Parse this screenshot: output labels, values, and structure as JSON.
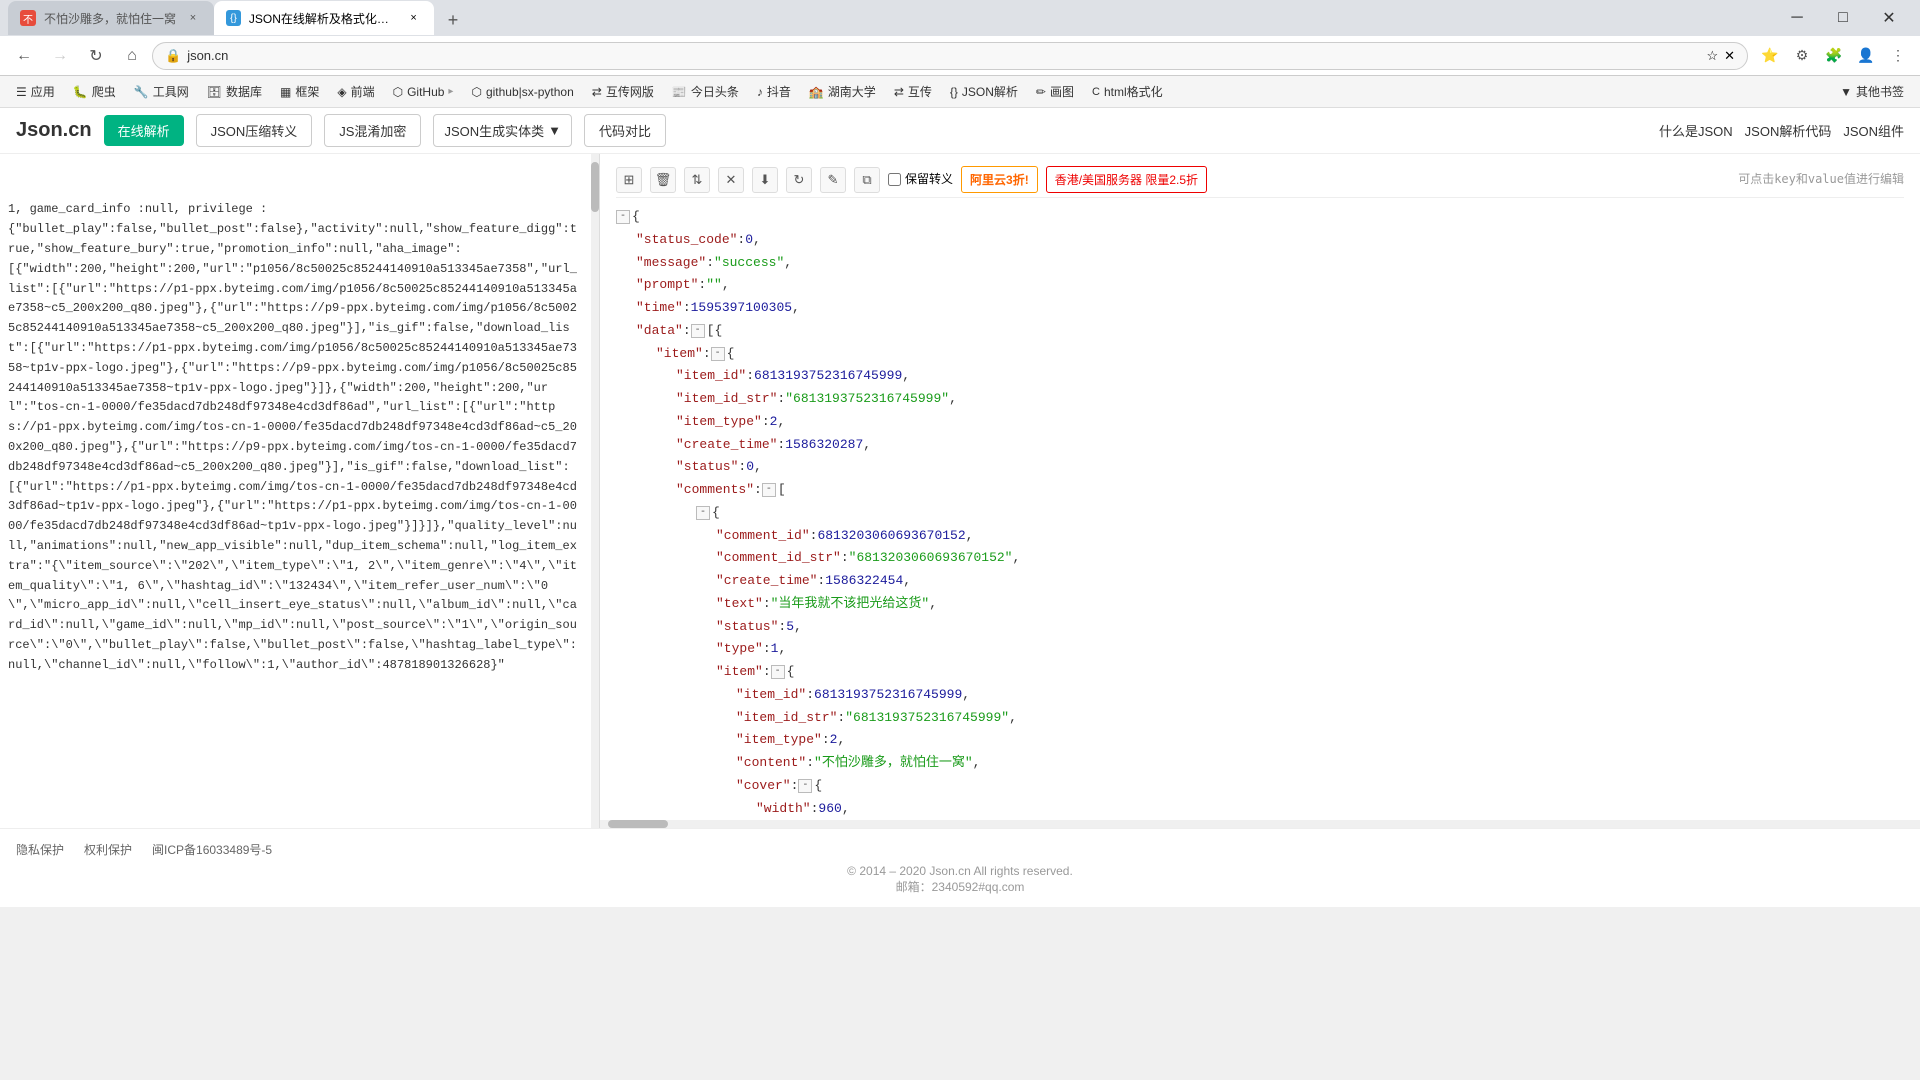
{
  "browser": {
    "tabs": [
      {
        "id": "tab1",
        "title": "不怕沙雕多，就怕住一窝",
        "active": false,
        "icon_type": "red",
        "icon_text": "不"
      },
      {
        "id": "tab2",
        "title": "JSON在线解析及格式化验证 -",
        "active": true,
        "icon_type": "blue",
        "icon_text": "{}"
      }
    ],
    "new_tab_label": "+",
    "address": "json.cn",
    "nav_back_disabled": false,
    "nav_forward_disabled": true
  },
  "bookmarks": [
    {
      "label": "应用",
      "icon": "☰"
    },
    {
      "label": "爬虫",
      "icon": "🐛"
    },
    {
      "label": "工具网",
      "icon": "🔧"
    },
    {
      "label": "数据库",
      "icon": "🗄"
    },
    {
      "label": "框架",
      "icon": "▦"
    },
    {
      "label": "前端",
      "icon": "◈"
    },
    {
      "label": "GitHub",
      "icon": "⬡"
    },
    {
      "label": "github|sx-python",
      "icon": "⬡"
    },
    {
      "label": "互传网版",
      "icon": "⇄"
    },
    {
      "label": "今日头条",
      "icon": "📰"
    },
    {
      "label": "抖音",
      "icon": "♪"
    },
    {
      "label": "湖南大学",
      "icon": "🏫"
    },
    {
      "label": "互传",
      "icon": "⇄"
    },
    {
      "label": "JSON解析",
      "icon": "{}"
    },
    {
      "label": "画图",
      "icon": "✏"
    },
    {
      "label": "html格式化",
      "icon": "< >"
    },
    {
      "label": "其他书签",
      "icon": "▼"
    }
  ],
  "site": {
    "logo": "Json.cn",
    "nav_items": [
      {
        "label": "在线解析",
        "active": true
      },
      {
        "label": "JSON压缩转义"
      },
      {
        "label": "JS混淆加密"
      },
      {
        "label": "JSON生成实体类",
        "has_dropdown": true
      },
      {
        "label": "代码对比"
      }
    ],
    "header_links": [
      {
        "label": "什么是JSON"
      },
      {
        "label": "JSON解析代码"
      },
      {
        "label": "JSON组件"
      }
    ]
  },
  "left_panel": {
    "content": "1, game_card_info :null, privilege :\n{\"bullet_play\":false,\"bullet_post\":false},\"activity\":null,\"show_feature_digg\":true,\"show_feature_bury\":true,\"promotion_info\":null,\"aha_image\":\n[[\"width\":200,\"height\":200,\"url\":\"p1056/8c50025c85244140910a513345ae7358\",\"url_list\":[{\"url\":\"https://p1-ppx.byteimg.com/img/p1056/8c50025c85244140910a513345ae7358~c5_200x200_q80.jpeg\"},{\"url\":\"https://p9-ppx.byteimg.com/img/p1056/8c50025c85244140910a513345ae7358~c5_200x200_q80.jpeg\"}],\"is_gif\":false,\"download_list\":[{\"url\":\"https://p1-ppx.byteimg.com/img/p1056/8c50025c85244140910a513345ae7358~tp1v-ppx-logo.jpeg\"},{\"url\":\"https://p9-ppx.byteimg.com/img/p1056/8c50025c85244140910a513345ae7358~tp1v-ppx-logo.jpeg\"}]},{\"width\":200,\"height\":200,\"url\":\"tos-cn-1-0000/fe35dacd7db248df97348e4cd3df86ad\",\"url_list\":[{\"url\":\"https://p1-ppx.byteimg.com/img/tos-cn-1-0000/fe35dacd7db248df97348e4cd3df86ad~c5_200x200_q80.jpeg\"},{\"url\":\"https://p9-ppx.byteimg.com/img/tos-cn-1-0000/fe35dacd7db248df97348e4cd3df86ad~c5_200x200_q80.jpeg\"}],\"is_gif\":false,\"download_list\":[{\"url\":\"https://p1-ppx.byteimg.com/img/tos-cn-1-0000/fe35dacd7db248df97348e4cd3df86ad~tp1v-ppx-logo.jpeg\"},{\"url\":\"https://p1-ppx.byteimg.com/img/tos-cn-1-0000/fe35dacd7db248df97348e4cd3df86ad~tp1v-ppx-logo.jpeg\"}]]},\"quality_level\":null,\"animations\":null,\"new_app_visible\":null,\"dup_item_schema\":null,\"log_item_extra\":\"{\\\"item_source\\\":\\\"202\\\",\\\"item_type\\\":\\\"1, 2\\\",\\\"item_genre\\\":\\\"4\\\",\\\"item_quality\\\":\\\"1, 6\\\",\\\"hashtag_id\\\":\\\"132434\\\",\\\"item_refer_user_num\\\":\\\"0\\\",\\\"micro_app_id\\\":null,\\\"cell_insert_eye_status\\\":null,\\\"album_id\\\":null,\\\"card_id\\\":null,\\\"game_id\\\":null,\\\"mp_id\\\":null,\\\"post_source\\\":\\\"1\\\",\\\"origin_source\\\":\\\"0\\\",\\\"bullet_play\\\":false,\\\"bullet_post\\\":false,\\\"hashtag_label_type\\\":null,\\\"channel_id\\\":null,\\\"follow\\\":1,\\\"author_id\\\":487818901326628}\"}"
  },
  "right_panel": {
    "toolbar": {
      "buttons": [
        {
          "name": "grid-btn",
          "icon": "⊞"
        },
        {
          "name": "delete-btn",
          "icon": "🗑"
        },
        {
          "name": "sort-btn",
          "icon": "⇅"
        },
        {
          "name": "clear-btn",
          "icon": "✕"
        },
        {
          "name": "download-btn",
          "icon": "⬇"
        },
        {
          "name": "refresh-btn",
          "icon": "↻"
        },
        {
          "name": "edit-btn",
          "icon": "✎"
        },
        {
          "name": "copy-btn",
          "icon": "⧉"
        }
      ],
      "checkbox_label": "保留转义",
      "ad1": "阿里云3折!",
      "ad2": "香港/美国服务器 限量2.5折",
      "hint": "可点击key和value值进行编辑"
    },
    "json_tree": [
      {
        "indent": 0,
        "content": "{",
        "type": "bracket",
        "collapsible": true
      },
      {
        "indent": 1,
        "key": "status_code",
        "value": "0",
        "value_type": "number",
        "comma": true
      },
      {
        "indent": 1,
        "key": "message",
        "value": "\"success\"",
        "value_type": "string",
        "comma": true
      },
      {
        "indent": 1,
        "key": "prompt",
        "value": "\"\"",
        "value_type": "string",
        "comma": true
      },
      {
        "indent": 1,
        "key": "time",
        "value": "1595397100305",
        "value_type": "number",
        "comma": true
      },
      {
        "indent": 1,
        "key": "data",
        "value": ":{[",
        "value_type": "bracket",
        "comma": false,
        "collapsible": true
      },
      {
        "indent": 2,
        "key": "item",
        "value": ":⊞{",
        "value_type": "bracket",
        "comma": false,
        "collapsible": true
      },
      {
        "indent": 3,
        "key": "item_id",
        "value": "6813193752316745999",
        "value_type": "number",
        "comma": true
      },
      {
        "indent": 3,
        "key": "item_id_str",
        "value": "\"6813193752316745999\"",
        "value_type": "string",
        "comma": true
      },
      {
        "indent": 3,
        "key": "item_type",
        "value": "2",
        "value_type": "number",
        "comma": true
      },
      {
        "indent": 3,
        "key": "create_time",
        "value": "1586320287",
        "value_type": "number",
        "comma": true
      },
      {
        "indent": 3,
        "key": "status",
        "value": "0",
        "value_type": "number",
        "comma": true
      },
      {
        "indent": 3,
        "key": "comments",
        "value": ":⊞[",
        "value_type": "bracket",
        "comma": false,
        "collapsible": true
      },
      {
        "indent": 4,
        "content": "⊞{",
        "value_type": "bracket",
        "collapsible": true
      },
      {
        "indent": 5,
        "key": "comment_id",
        "value": "6813203060693670152",
        "value_type": "number",
        "comma": true
      },
      {
        "indent": 5,
        "key": "comment_id_str",
        "value": "\"6813203060693670152\"",
        "value_type": "string",
        "comma": true
      },
      {
        "indent": 5,
        "key": "create_time",
        "value": "1586322454",
        "value_type": "number",
        "comma": true
      },
      {
        "indent": 5,
        "key": "text",
        "value": "\"当年我就不该把光给这货\"",
        "value_type": "string",
        "comma": true
      },
      {
        "indent": 5,
        "key": "status",
        "value": "5",
        "value_type": "number",
        "comma": true
      },
      {
        "indent": 5,
        "key": "type",
        "value": "1",
        "value_type": "number",
        "comma": true
      },
      {
        "indent": 5,
        "key": "item",
        "value": ":⊞{",
        "value_type": "bracket",
        "comma": false,
        "collapsible": true
      },
      {
        "indent": 6,
        "key": "item_id",
        "value": "6813193752316745999",
        "value_type": "number",
        "comma": true
      },
      {
        "indent": 6,
        "key": "item_id_str",
        "value": "\"6813193752316745999\"",
        "value_type": "string",
        "comma": true
      },
      {
        "indent": 6,
        "key": "item_type",
        "value": "2",
        "value_type": "number",
        "comma": true
      },
      {
        "indent": 6,
        "key": "content",
        "value": "\"不怕沙雕多，就怕住一窝\"",
        "value_type": "string",
        "comma": true
      },
      {
        "indent": 6,
        "key": "cover",
        "value": ":⊞{",
        "value_type": "bracket",
        "comma": false,
        "collapsible": true
      },
      {
        "indent": 7,
        "key": "width",
        "value": "960",
        "value_type": "number",
        "comma": true
      }
    ]
  },
  "footer": {
    "links": [
      {
        "label": "隐私保护"
      },
      {
        "label": "权利保护"
      },
      {
        "label": "闽ICP备16033489号-5"
      }
    ],
    "copyright": "© 2014 – 2020 Json.cn All rights reserved.",
    "email": "邮箱：2340592#qq.com"
  }
}
